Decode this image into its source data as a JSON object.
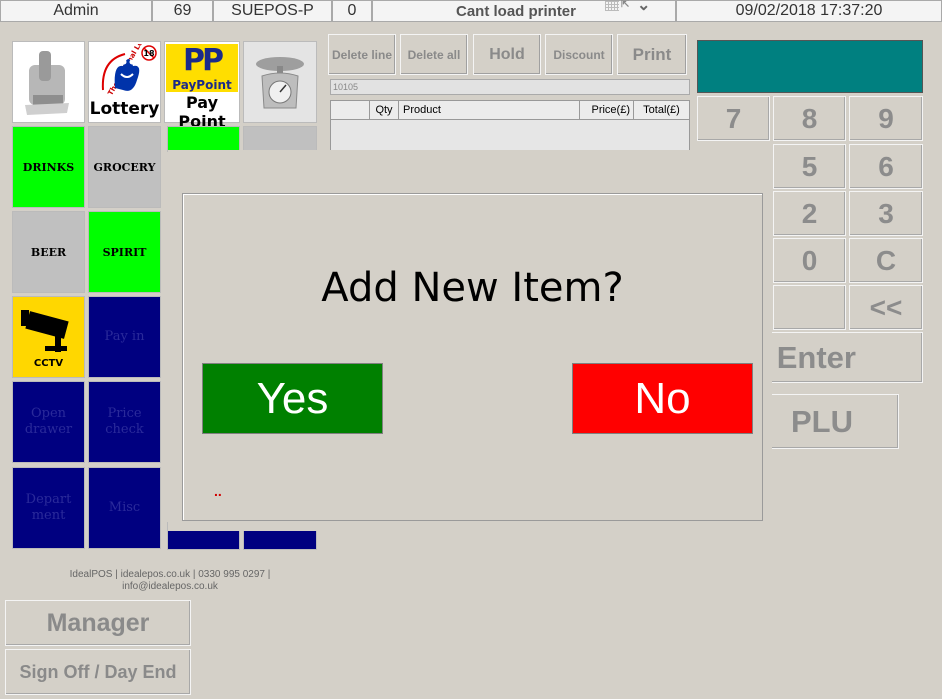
{
  "topbar": {
    "user": "Admin",
    "station": "69",
    "terminal": "SUEPOS-P",
    "count": "0",
    "printer_status": "Cant load printer",
    "datetime": "09/02/2018 17:37:20"
  },
  "tiles": {
    "lottery_label": "Lottery",
    "lottery_badge": "18",
    "lottery_arc": "The National Lottery",
    "paypoint_logo": "PP",
    "paypoint_brand": "PayPoint",
    "paypoint_label": "Pay Point",
    "drinks": "DRINKS",
    "grocery": "GROCERY",
    "beer": "BEER",
    "spirit": "SPIRIT",
    "cctv": "CCTV",
    "pay_in": "Pay in",
    "open_drawer": "Open drawer",
    "price_check": "Price check",
    "department": "Depart ment",
    "misc": "Misc"
  },
  "actions": {
    "delete_line": "Delete line",
    "delete_all": "Delete all",
    "hold": "Hold",
    "discount": "Discount",
    "print": "Print"
  },
  "transaction": {
    "number": "10105",
    "columns": [
      "",
      "Qty",
      "Product",
      "Price(£)",
      "Total(£)"
    ]
  },
  "display": {
    "color": "#008080"
  },
  "keypad": {
    "k7": "7",
    "k8": "8",
    "k9": "9",
    "k5": "5",
    "k6": "6",
    "k2": "2",
    "k3": "3",
    "k0": "0",
    "clear": "C",
    "back": "<<",
    "enter": "Enter",
    "plu": "PLU"
  },
  "footer": {
    "credits_line1": "IdealPOS | idealepos.co.uk | 0330 995 0297 |",
    "credits_line2": "info@idealepos.co.uk"
  },
  "bottom_buttons": {
    "manager": "Manager",
    "sign_off": "Sign Off / Day End"
  },
  "dialog": {
    "question": "Add New Item?",
    "yes": "Yes",
    "no": "No",
    "yes_color": "#008000",
    "no_color": "#ff0000",
    "marker": ".."
  }
}
